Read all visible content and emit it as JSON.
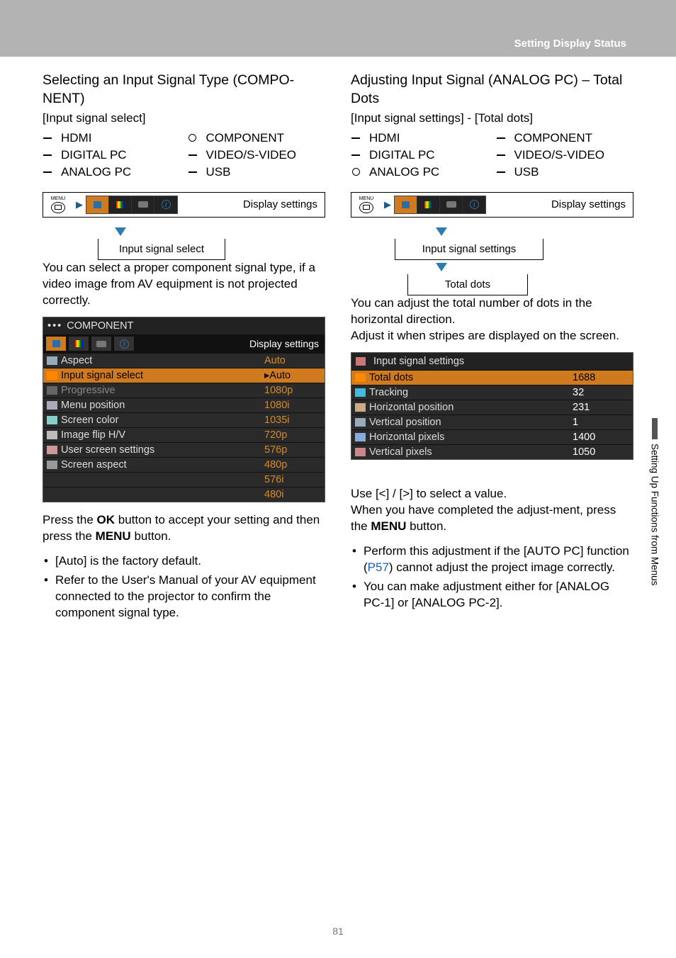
{
  "header": {
    "section": "Setting Display Status"
  },
  "page_number": "81",
  "side_tab": "Setting Up Functions from Menus",
  "left": {
    "title": "Selecting an Input Signal Type (COMPO-NENT)",
    "subhead": "[Input signal select]",
    "signals": [
      {
        "label": "HDMI",
        "selected": false
      },
      {
        "label": "COMPONENT",
        "selected": true
      },
      {
        "label": "DIGITAL PC",
        "selected": false
      },
      {
        "label": "VIDEO/S-VIDEO",
        "selected": false
      },
      {
        "label": "ANALOG PC",
        "selected": false
      },
      {
        "label": "USB",
        "selected": false
      }
    ],
    "nav": {
      "menu_label": "MENU",
      "top_label": "Display settings",
      "sub1": "Input signal select"
    },
    "para1": "You can select a proper component signal type, if a video image from AV equipment is not projected correctly.",
    "menu_screenshot": {
      "title": "COMPONENT",
      "tab_label": "Display settings",
      "rows": [
        {
          "label": "Aspect",
          "value": "Auto",
          "hl": false,
          "icon": "#9ab"
        },
        {
          "label": "Input signal select",
          "value": "▸Auto",
          "hl": true,
          "icon": "#f80"
        },
        {
          "label": "Progressive",
          "value": "1080p",
          "hl": false,
          "dim": true,
          "icon": "#666"
        },
        {
          "label": "Menu position",
          "value": "1080i",
          "hl": false,
          "icon": "#aab"
        },
        {
          "label": "Screen color",
          "value": "1035i",
          "hl": false,
          "icon": "#8cc"
        },
        {
          "label": "Image flip H/V",
          "value": "720p",
          "hl": false,
          "icon": "#bbb"
        },
        {
          "label": "User screen settings",
          "value": "576p",
          "hl": false,
          "icon": "#c99"
        },
        {
          "label": "Screen aspect",
          "value": "480p",
          "hl": false,
          "icon": "#999"
        },
        {
          "label": "",
          "value": "576i",
          "hl": false
        },
        {
          "label": "",
          "value": "480i",
          "hl": false
        }
      ]
    },
    "para2_a": "Press the ",
    "para2_b": "OK",
    "para2_c": " button to accept your setting and then press the ",
    "para2_d": "MENU",
    "para2_e": " button.",
    "bullets": [
      "[Auto] is the factory default.",
      "Refer to the User's Manual of your AV equipment connected to the projector to confirm the component signal type."
    ]
  },
  "right": {
    "title": "Adjusting Input Signal (ANALOG PC) – Total Dots",
    "subhead": "[Input signal settings] - [Total dots]",
    "signals": [
      {
        "label": "HDMI",
        "selected": false
      },
      {
        "label": "COMPONENT",
        "selected": false
      },
      {
        "label": "DIGITAL PC",
        "selected": false
      },
      {
        "label": "VIDEO/S-VIDEO",
        "selected": false
      },
      {
        "label": "ANALOG PC",
        "selected": true
      },
      {
        "label": "USB",
        "selected": false
      }
    ],
    "nav": {
      "menu_label": "MENU",
      "top_label": "Display settings",
      "sub1": "Input signal settings",
      "sub2": "Total dots"
    },
    "para1": "You can adjust the total number of dots in the horizontal direction.\nAdjust it when stripes are displayed on the screen.",
    "menu_screenshot": {
      "title": "Input signal settings",
      "rows": [
        {
          "label": "Total dots",
          "value": "1688",
          "hl": true,
          "icon": "#f80"
        },
        {
          "label": "Tracking",
          "value": "32",
          "hl": false,
          "icon": "#4bd"
        },
        {
          "label": "Horizontal position",
          "value": "231",
          "hl": false,
          "icon": "#ca8"
        },
        {
          "label": "Vertical position",
          "value": "1",
          "hl": false,
          "icon": "#9ab"
        },
        {
          "label": "Horizontal pixels",
          "value": "1400",
          "hl": false,
          "icon": "#8ad"
        },
        {
          "label": "Vertical pixels",
          "value": "1050",
          "hl": false,
          "icon": "#c88"
        }
      ]
    },
    "para2": "Use [<] / [>] to select a value.\nWhen you have completed the adjust-ment, press the ",
    "para2_bold": "MENU",
    "para2_end": " button.",
    "bullets": [
      {
        "pre": "Perform this adjustment if the [AUTO PC] function (",
        "link": "P57",
        "post": ") cannot adjust the project image correctly."
      },
      {
        "pre": "You can make adjustment either for [ANALOG PC-1] or [ANALOG PC-2].",
        "link": "",
        "post": ""
      }
    ]
  }
}
